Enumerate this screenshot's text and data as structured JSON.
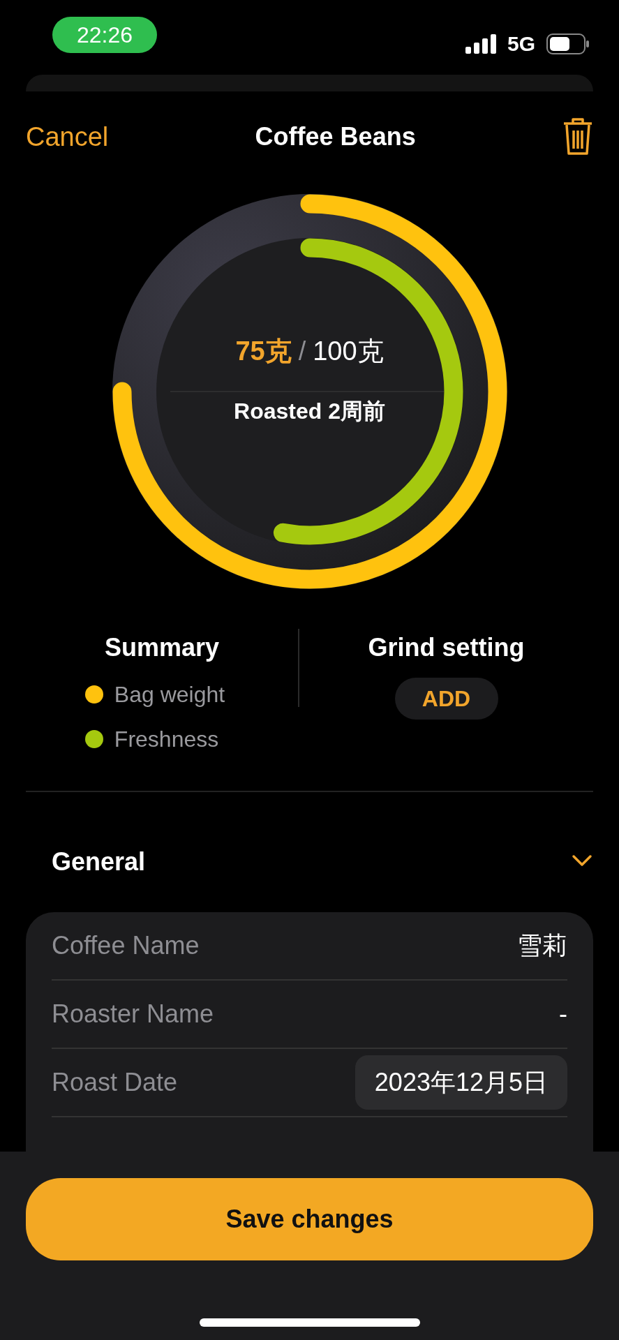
{
  "status_bar": {
    "time": "22:26",
    "network": "5G"
  },
  "nav": {
    "cancel": "Cancel",
    "title": "Coffee Beans"
  },
  "gauge": {
    "remaining": "75克",
    "separator": "/",
    "total": "100克",
    "roasted": "Roasted 2周前"
  },
  "summary": {
    "title": "Summary",
    "legend": [
      {
        "label": "Bag weight",
        "color": "#ffc20e",
        "level": 0.75
      },
      {
        "label": "Freshness",
        "color": "#a5c90f",
        "level": 0.53
      }
    ]
  },
  "grind": {
    "title": "Grind setting",
    "button": "ADD"
  },
  "general": {
    "title": "General",
    "expanded": true,
    "rows": [
      {
        "label": "Coffee Name",
        "value": "雪莉",
        "kind": "text"
      },
      {
        "label": "Roaster Name",
        "value": "-",
        "kind": "text"
      },
      {
        "label": "Roast Date",
        "value": "2023年12月5日",
        "kind": "date"
      }
    ]
  },
  "save_button": "Save changes"
}
